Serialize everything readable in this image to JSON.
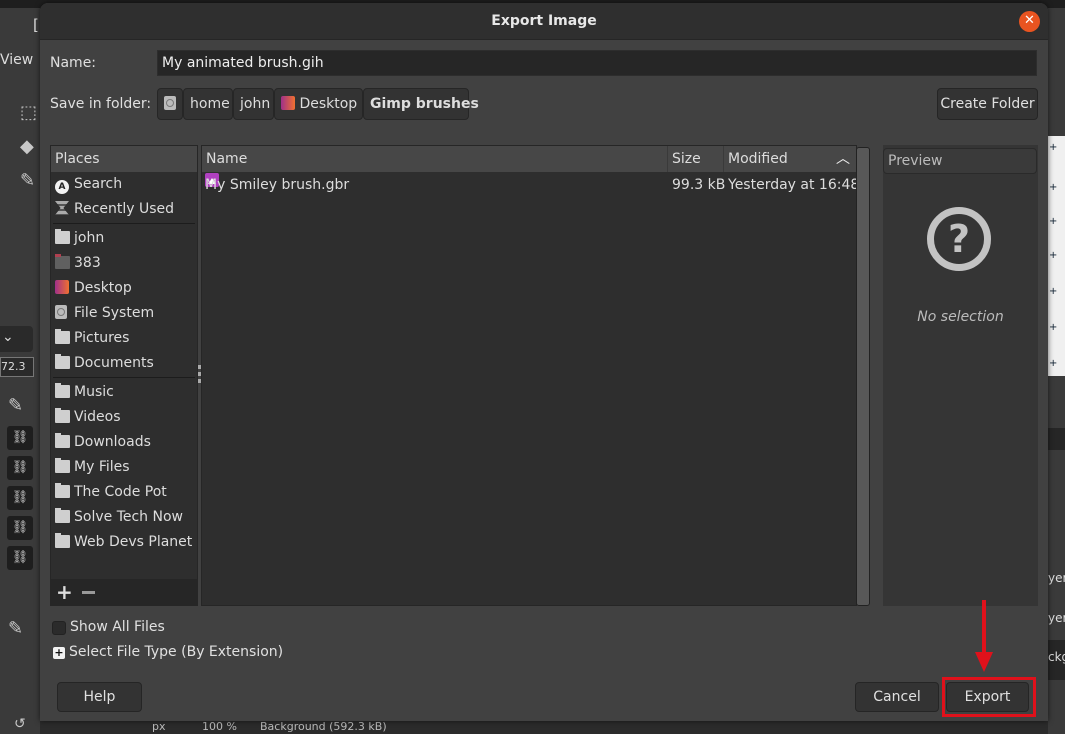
{
  "background_app": {
    "menu_view": "View",
    "title_fragment": "[",
    "spin_value": "72.3",
    "status_units": "px",
    "status_zoom": "100 %",
    "status_layer": "Background (592.3 kB)",
    "right_texts": [
      "yer",
      "yer",
      "ckg"
    ]
  },
  "dialog": {
    "title": "Export Image",
    "close_icon": "close-icon",
    "name_label": "Name:",
    "name_value": "My animated brush.gih",
    "folder_label": "Save in folder:",
    "breadcrumbs": [
      {
        "label": "",
        "icon": "disk-icon"
      },
      {
        "label": "home"
      },
      {
        "label": "john"
      },
      {
        "label": "Desktop",
        "icon": "desktop-icon"
      },
      {
        "label": "Gimp brushes",
        "active": true
      }
    ],
    "create_folder": "Create Folder",
    "places": {
      "header": "Places",
      "items": [
        {
          "label": "Search",
          "icon": "search-icon"
        },
        {
          "label": "Recently Used",
          "icon": "recent-icon"
        },
        {
          "label": "john",
          "icon": "folder-icon"
        },
        {
          "label": "383",
          "icon": "folder-red-icon"
        },
        {
          "label": "Desktop",
          "icon": "desktop-icon"
        },
        {
          "label": "File System",
          "icon": "disk-icon"
        },
        {
          "label": "Pictures",
          "icon": "folder-icon"
        },
        {
          "label": "Documents",
          "icon": "folder-icon"
        },
        {
          "label": "Music",
          "icon": "folder-icon"
        },
        {
          "label": "Videos",
          "icon": "folder-icon"
        },
        {
          "label": "Downloads",
          "icon": "folder-icon"
        },
        {
          "label": "My Files",
          "icon": "folder-icon"
        },
        {
          "label": "The Code Pot",
          "icon": "folder-icon"
        },
        {
          "label": "Solve Tech Now",
          "icon": "folder-icon"
        },
        {
          "label": "Web Devs Planet",
          "icon": "folder-icon"
        }
      ],
      "add_symbol": "+"
    },
    "files": {
      "columns": [
        "Name",
        "Size",
        "Modified"
      ],
      "sort_icon": "^",
      "rows": [
        {
          "name": "My Smiley brush.gbr",
          "size": "99.3 kB",
          "modified": "Yesterday at 16:48"
        }
      ]
    },
    "preview": {
      "header": "Preview",
      "icon_glyph": "?",
      "no_selection": "No selection"
    },
    "show_all_files": "Show All Files",
    "show_all_checked": false,
    "select_file_type": "Select File Type (By Extension)",
    "expander_symbol": "+",
    "help": "Help",
    "cancel": "Cancel",
    "export": "Export",
    "annotation_color": "#e0111b",
    "accent_close": "#e95420"
  }
}
